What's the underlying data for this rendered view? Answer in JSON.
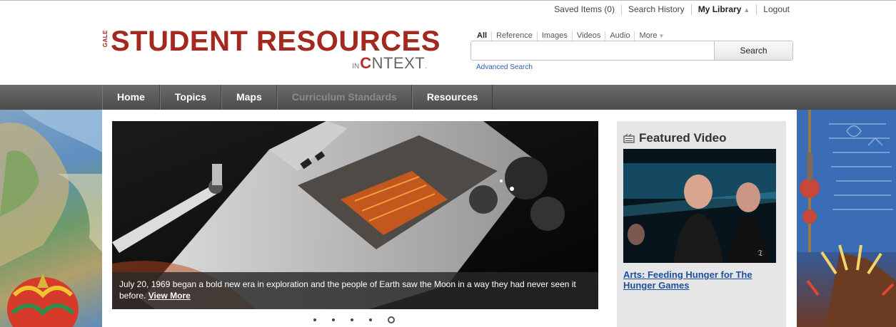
{
  "utility": {
    "items": [
      {
        "label": "Saved Items (0)"
      },
      {
        "label": "Search History"
      },
      {
        "label": "My Library"
      },
      {
        "label": "Logout"
      }
    ]
  },
  "logo": {
    "gale": "GALE",
    "title": "STUDENT RESOURCES",
    "sub_in": "IN",
    "sub_c": "C",
    "sub_rest": "NTEXT",
    "sub_mark": "."
  },
  "search": {
    "tabs": [
      "All",
      "Reference",
      "Images",
      "Videos",
      "Audio",
      "More"
    ],
    "placeholder": "",
    "button": "Search",
    "advanced": "Advanced Search"
  },
  "nav": {
    "items": [
      "Home",
      "Topics",
      "Maps",
      "Curriculum Standards",
      "Resources"
    ]
  },
  "hero": {
    "caption": "July 20, 1969 began a bold new era in exploration and the people of Earth saw the Moon in a way they had never seen it before.",
    "more": "View More",
    "slides": 5,
    "active_slide": 5
  },
  "featured": {
    "heading": "Featured Video",
    "link": "Arts: Feeding Hunger for The Hunger Games"
  },
  "colors": {
    "brand_red": "#a3281f",
    "link_blue": "#1d4f9b",
    "nav_bg": "#5a5a5a"
  }
}
